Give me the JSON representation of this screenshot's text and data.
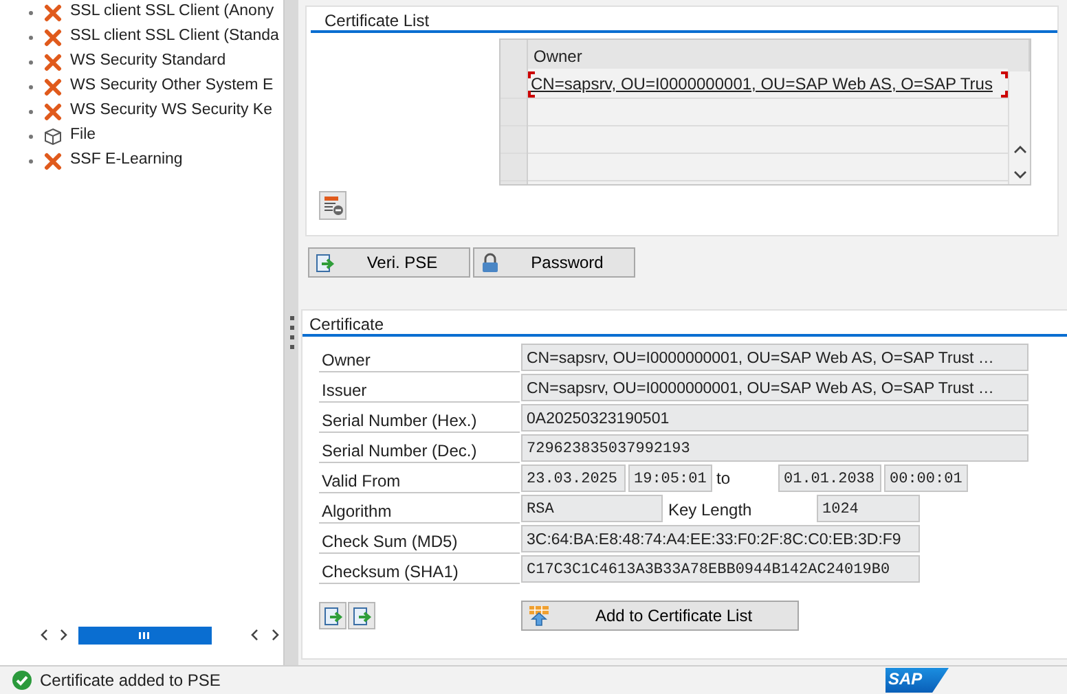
{
  "tree": {
    "items": [
      {
        "kind": "error",
        "label": "SSL client SSL Client (Anony"
      },
      {
        "kind": "error",
        "label": "SSL client SSL Client (Standa"
      },
      {
        "kind": "error",
        "label": "WS Security Standard"
      },
      {
        "kind": "error",
        "label": "WS Security Other System E"
      },
      {
        "kind": "error",
        "label": "WS Security WS Security Ke"
      },
      {
        "kind": "file",
        "label": "File"
      },
      {
        "kind": "error",
        "label": "SSF E-Learning"
      }
    ]
  },
  "certificate_list": {
    "title": "Certificate List",
    "columns": [
      "Owner"
    ],
    "rows": [
      {
        "owner": "CN=sapsrv, OU=I0000000001, OU=SAP Web AS, O=SAP Trus",
        "focused": true
      }
    ]
  },
  "buttons": [
    {
      "kind": "verify",
      "label": "Veri. PSE"
    },
    {
      "kind": "lock",
      "label": "Password"
    }
  ],
  "certificate": {
    "title": "Certificate",
    "rows": [
      {
        "kind": "wide",
        "label": "Owner",
        "value": "CN=sapsrv, OU=I0000000001, OU=SAP Web AS, O=SAP Trust …"
      },
      {
        "kind": "wide",
        "label": "Issuer",
        "value": "CN=sapsrv, OU=I0000000001, OU=SAP Web AS, O=SAP Trust …"
      },
      {
        "kind": "wide",
        "label": "Serial Number (Hex.)",
        "value": "0A20250323190501"
      },
      {
        "kind": "wide_mono",
        "label": "Serial Number (Dec.)",
        "value": "729623835037992193"
      },
      {
        "kind": "dates",
        "label": "Valid From",
        "from_date": "23.03.2025",
        "from_time": "19:05:01",
        "separator": "to",
        "to_date": "01.01.2038",
        "to_time": "00:00:01"
      },
      {
        "kind": "pair",
        "label": "Algorithm",
        "value": "RSA",
        "label2": "Key Length",
        "value2": "1024"
      },
      {
        "kind": "medium",
        "label": "Check Sum (MD5)",
        "value": "3C:64:BA:E8:48:74:A4:EE:33:F0:2F:8C:C0:EB:3D:F9"
      },
      {
        "kind": "medium_mono",
        "label": "Checksum (SHA1)",
        "value": "C17C3C1C4613A3B33A78EBB0944B142AC24019B0"
      }
    ],
    "add_button": "Add to Certificate List"
  },
  "status_bar": {
    "kind": "success",
    "message": "Certificate added to PSE",
    "logo": "SAP"
  }
}
